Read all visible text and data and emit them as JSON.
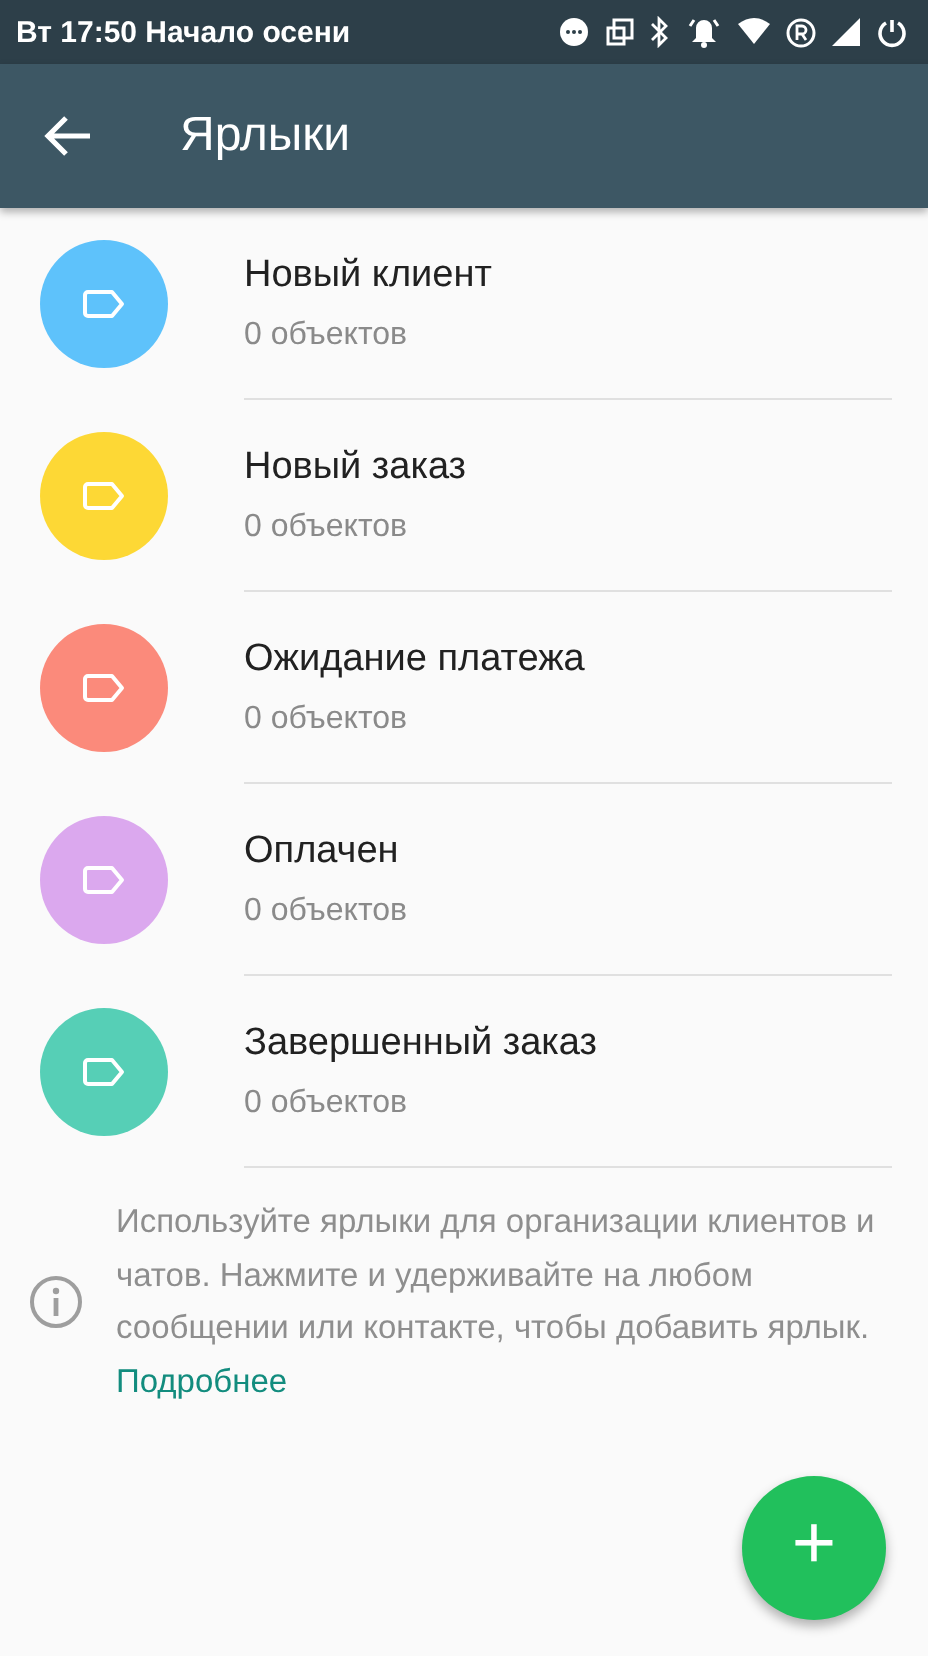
{
  "status_bar": {
    "text": "Вт 17:50 Начало осени"
  },
  "app_bar": {
    "title": "Ярлыки"
  },
  "labels": [
    {
      "name": "Новый клиент",
      "count": "0 объектов",
      "color": "#5ec2fb"
    },
    {
      "name": "Новый заказ",
      "count": "0 объектов",
      "color": "#fdd835"
    },
    {
      "name": "Ожидание платежа",
      "count": "0 объектов",
      "color": "#fb8a7b"
    },
    {
      "name": "Оплачен",
      "count": "0 объектов",
      "color": "#dba8ee"
    },
    {
      "name": "Завершенный заказ",
      "count": "0 объектов",
      "color": "#56cfb6"
    }
  ],
  "info": {
    "text": "Используйте ярлыки для организации клиентов и чатов. Нажмите и удерживайте на любом сообщении или контакте, чтобы добавить ярлык.",
    "link": "Подробнее"
  },
  "fab": {
    "symbol": "+"
  }
}
